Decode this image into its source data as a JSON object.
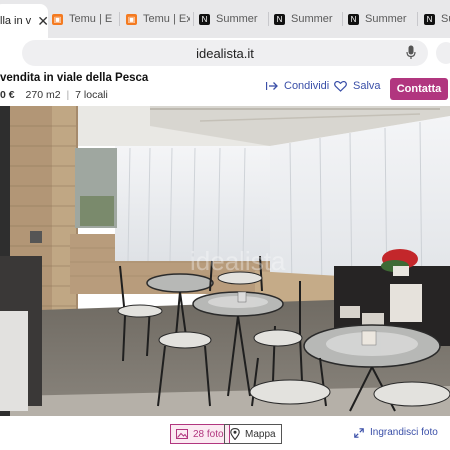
{
  "browser": {
    "tabs": [
      {
        "label": "lla in v",
        "favicon": "idealista-icon",
        "active": true
      },
      {
        "label": "Temu | Explo",
        "favicon": "temu-icon"
      },
      {
        "label": "Temu | Explo",
        "favicon": "temu-icon"
      },
      {
        "label": "Summer Day",
        "favicon": "notion-icon"
      },
      {
        "label": "Summer Day",
        "favicon": "notion-icon"
      },
      {
        "label": "Summer Day",
        "favicon": "notion-icon"
      },
      {
        "label": "Summer Day",
        "favicon": "notion-icon"
      }
    ],
    "url": "idealista.it"
  },
  "listing": {
    "title": "vendita in viale della Pesca",
    "price": "0 €",
    "size": "270 m2",
    "rooms": "7 locali",
    "actions": {
      "share": "Condividi",
      "save": "Salva",
      "contact": "Contatta"
    },
    "photo_watermark": "idealista"
  },
  "footer": {
    "photos": "28 foto",
    "map": "Mappa",
    "enlarge": "Ingrandisci foto"
  },
  "colors": {
    "brand": "#b1367f",
    "link": "#3a4fa8"
  }
}
